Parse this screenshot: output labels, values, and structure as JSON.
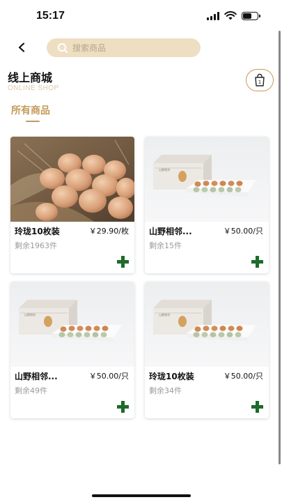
{
  "status_bar": {
    "time": "15:17"
  },
  "header": {
    "search_placeholder": "搜索商品",
    "shop_title": "线上商城",
    "shop_subtitle": "ONLINE SHOP"
  },
  "cart": {
    "count": "1"
  },
  "tab": {
    "label": "所有商品"
  },
  "colors": {
    "accent": "#c49a5a",
    "search_bg": "#efdfc2",
    "add_button": "#1e6b2a"
  },
  "products": [
    {
      "name": "玲珑10枚装",
      "price": "￥29.90/枚",
      "stock": "剩余1963件",
      "image": "photo-eggs-basket"
    },
    {
      "name": "山野相邻...",
      "price": "￥50.00/只",
      "stock": "剩余15件",
      "image": "egg-gift-box"
    },
    {
      "name": "山野相邻...",
      "price": "￥50.00/只",
      "stock": "剩余49件",
      "image": "egg-gift-box"
    },
    {
      "name": "玲珑10枚装",
      "price": "￥50.00/只",
      "stock": "剩余34件",
      "image": "egg-gift-box"
    }
  ]
}
